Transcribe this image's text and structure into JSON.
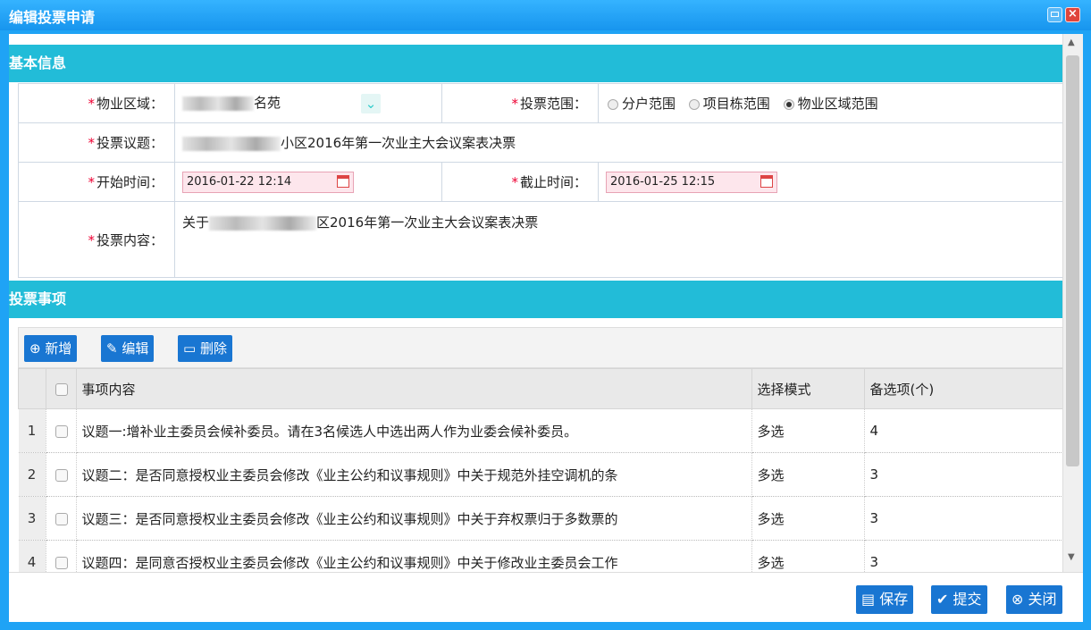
{
  "window": {
    "title": "编辑投票申请"
  },
  "sections": {
    "basic": "基本信息",
    "items": "投票事项"
  },
  "form": {
    "area_label": "物业区域：",
    "area_value": "名苑",
    "scope_label": "投票范围：",
    "scope_options": [
      "分户范围",
      "项目栋范围",
      "物业区域范围"
    ],
    "scope_selected": "物业区域范围",
    "topic_label": "投票议题：",
    "topic_value": "小区2016年第一次业主大会议案表决票",
    "start_label": "开始时间：",
    "start_value": "2016-01-22 12:14",
    "end_label": "截止时间：",
    "end_value": "2016-01-25 12:15",
    "content_label": "投票内容：",
    "content_prefix": "关于",
    "content_value": "区2016年第一次业主大会议案表决票",
    "required_mark": "*"
  },
  "toolbar": {
    "add": "新增",
    "edit": "编辑",
    "delete": "删除"
  },
  "grid": {
    "columns": [
      "事项内容",
      "选择模式",
      "备选项(个)"
    ],
    "rows": [
      {
        "n": "1",
        "content": "议题一:增补业主委员会候补委员。请在3名候选人中选出两人作为业委会候补委员。",
        "mode": "多选",
        "count": "4"
      },
      {
        "n": "2",
        "content": "议题二：是否同意授权业主委员会修改《业主公约和议事规则》中关于规范外挂空调机的条",
        "mode": "多选",
        "count": "3"
      },
      {
        "n": "3",
        "content": "议题三：是否同意授权业主委员会修改《业主公约和议事规则》中关于弃权票归于多数票的",
        "mode": "多选",
        "count": "3"
      },
      {
        "n": "4",
        "content": "议题四：是同意否授权业主委员会修改《业主公约和议事规则》中关于修改业主委员会工作",
        "mode": "多选",
        "count": "3"
      }
    ]
  },
  "footer": {
    "save": "保存",
    "submit": "提交",
    "close": "关闭"
  }
}
